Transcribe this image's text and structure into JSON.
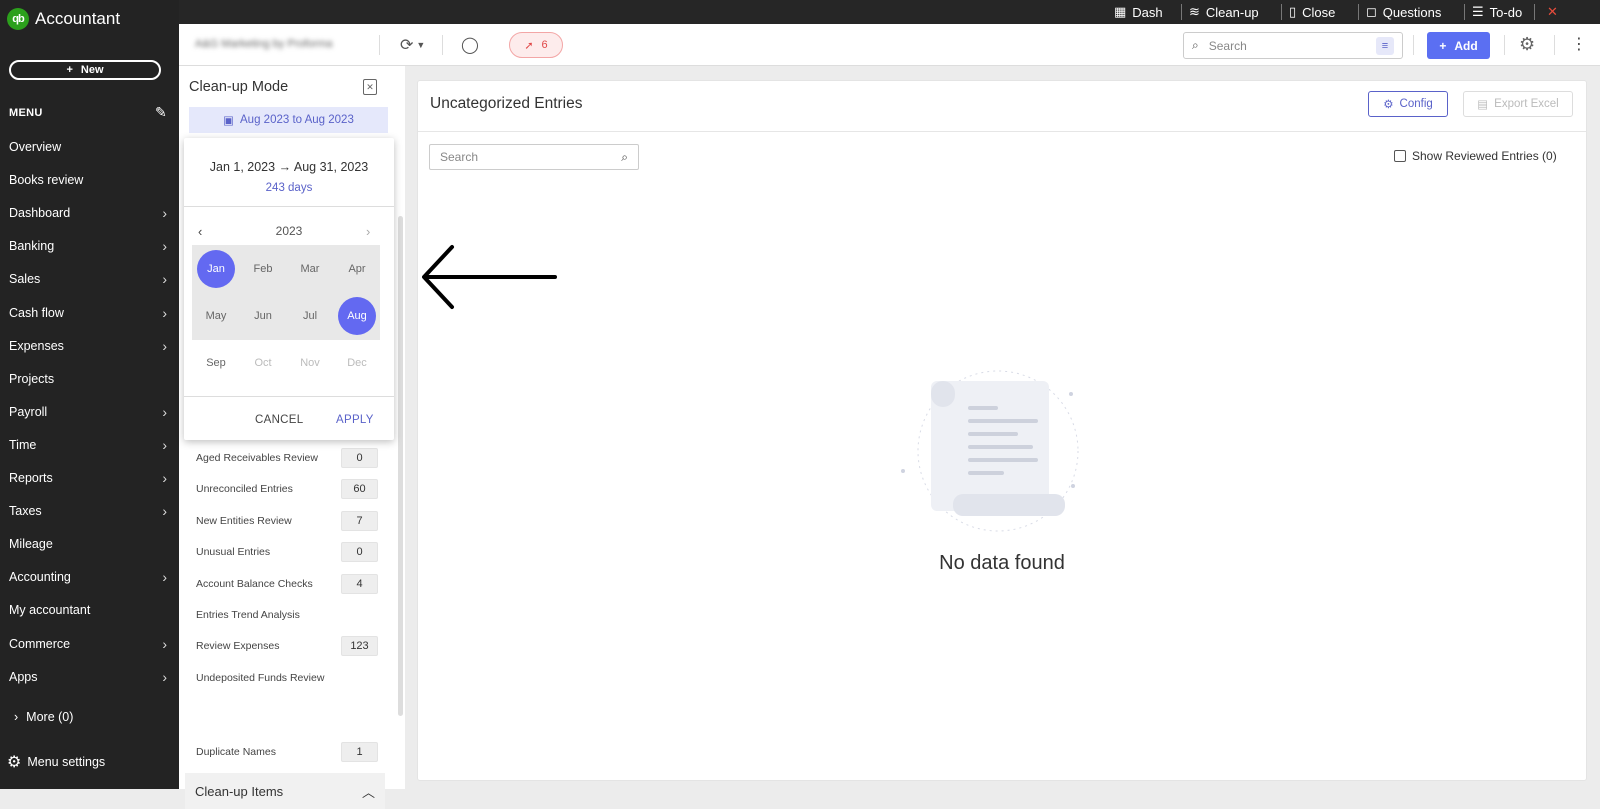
{
  "topstrip": {
    "items": [
      {
        "icon": "dashboard-icon",
        "label": "Dash"
      },
      {
        "icon": "cleanup-icon",
        "label": "Clean-up"
      },
      {
        "icon": "book-icon",
        "label": "Close"
      },
      {
        "icon": "question-icon",
        "label": "Questions"
      },
      {
        "icon": "checklist-icon",
        "label": "To-do"
      }
    ]
  },
  "sidebar": {
    "logo_mark": "qb",
    "logo_text": "Accountant",
    "new_label": "New",
    "menu_label": "MENU",
    "items": [
      {
        "label": "Overview",
        "chevron": false
      },
      {
        "label": "Books review",
        "chevron": false
      },
      {
        "label": "Dashboard",
        "chevron": true
      },
      {
        "label": "Banking",
        "chevron": true
      },
      {
        "label": "Sales",
        "chevron": true
      },
      {
        "label": "Cash flow",
        "chevron": true
      },
      {
        "label": "Expenses",
        "chevron": true
      },
      {
        "label": "Projects",
        "chevron": false
      },
      {
        "label": "Payroll",
        "chevron": true
      },
      {
        "label": "Time",
        "chevron": true
      },
      {
        "label": "Reports",
        "chevron": true
      },
      {
        "label": "Taxes",
        "chevron": true
      },
      {
        "label": "Mileage",
        "chevron": false
      },
      {
        "label": "Accounting",
        "chevron": true
      },
      {
        "label": "My accountant",
        "chevron": false
      },
      {
        "label": "Commerce",
        "chevron": true
      },
      {
        "label": "Apps",
        "chevron": true
      }
    ],
    "more_label": "More (0)",
    "settings_label": "Menu settings"
  },
  "header": {
    "company_name": "A&G Marketing by Proforma",
    "alert_count": "6",
    "search_placeholder": "Search",
    "add_label": "Add"
  },
  "left_panel": {
    "title": "Clean-up Mode",
    "date_range": "Aug 2023 to Aug 2023",
    "rows": [
      {
        "label": "Aged Receivables Review",
        "count": "0"
      },
      {
        "label": "Unreconciled Entries",
        "count": "60"
      },
      {
        "label": "New Entities Review",
        "count": "7"
      },
      {
        "label": "Unusual Entries",
        "count": "0"
      },
      {
        "label": "Account Balance Checks",
        "count": "4"
      },
      {
        "label": "Entries Trend Analysis",
        "count": ""
      },
      {
        "label": "Review Expenses",
        "count": "123"
      },
      {
        "label": "Undeposited Funds Review",
        "count": ""
      }
    ],
    "cleanup_items_label": "Clean-up Items",
    "cleanup_items": [
      {
        "label": "Duplicate Names",
        "count": "1"
      }
    ]
  },
  "date_popup": {
    "start": "Jan 1, 2023",
    "end": "Aug 31, 2023",
    "days": "243 days",
    "year": "2023",
    "months": [
      {
        "label": "Jan",
        "state": "selected"
      },
      {
        "label": "Feb",
        "state": "range"
      },
      {
        "label": "Mar",
        "state": "range"
      },
      {
        "label": "Apr",
        "state": "range"
      },
      {
        "label": "May",
        "state": "range"
      },
      {
        "label": "Jun",
        "state": "range"
      },
      {
        "label": "Jul",
        "state": "range"
      },
      {
        "label": "Aug",
        "state": "selected"
      },
      {
        "label": "Sep",
        "state": "normal"
      },
      {
        "label": "Oct",
        "state": "disabled"
      },
      {
        "label": "Nov",
        "state": "disabled"
      },
      {
        "label": "Dec",
        "state": "disabled"
      }
    ],
    "cancel_label": "CANCEL",
    "apply_label": "APPLY"
  },
  "main": {
    "title": "Uncategorized Entries",
    "config_label": "Config",
    "export_label": "Export Excel",
    "search_placeholder": "Search",
    "show_reviewed_label": "Show Reviewed Entries (0)",
    "empty_text": "No data found"
  },
  "colors": {
    "accent": "#5b6ff2",
    "sidebar_bg": "#232323",
    "brand_green": "#2ca01c",
    "alert_red": "#e04848"
  }
}
